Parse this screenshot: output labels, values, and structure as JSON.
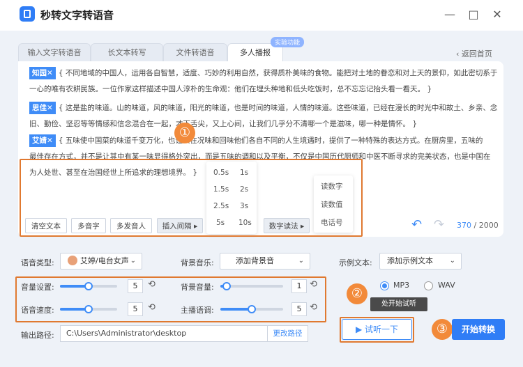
{
  "app": {
    "title": "秒转文字转语音",
    "logo": "app-logo-icon"
  },
  "window": {
    "minimize": "—",
    "restore": "□",
    "close": "✕"
  },
  "tabs": [
    {
      "label": "输入文字转语音",
      "active": false
    },
    {
      "label": "长文本转写",
      "active": false
    },
    {
      "label": "文件转语音",
      "active": false
    },
    {
      "label": "多人播报",
      "active": true
    }
  ],
  "badge": "实验功能",
  "back_label": "返回首页",
  "paragraphs": [
    {
      "tag": "知园✕",
      "lines": [
        "{ 不同地域的中国人，运用各自智慧，适度、巧妙的利用自然，获得质朴美味的食物。能把对土地的眷恋和对上天的景仰，如此密切系于",
        "一心的唯有农耕民族。一位作家这样描述中国人淳朴的生命观：他们在埋头种地和低头吃饭时，总不忘忘记抬头看一看天。 }"
      ]
    },
    {
      "tag": "思佳✕",
      "lines": [
        "{ 这是盐的味道。山的味道，风的味道，阳光的味道，也是时间的味道，人情的味道。这些味道，已经在漫长的时光中和故土、乡亲、念",
        "旧、勤俭、坚忍等等情感和信念混合在一起，才下舌尖，又上心间，让我们几乎分不清哪一个是滋味，哪一种是情怀。 }"
      ]
    },
    {
      "tag": "艾婧✕",
      "lines": [
        "{ 五味使中国菜的味道千变万化，也让人在况味和回味他们各自不同的人生境遇时，提供了一种特殊的表达方式。在厨房里，五味的",
        "最佳存在方式，并不是让其中有某一味显得格外突出，而是五味的调和以及平衡，不仅是中国历代厨师和中医不断寻求的完美状态，也是中国在",
        "为人处世、甚至在治国经世上所追求的理想境界。 }"
      ]
    }
  ],
  "pause_popup": [
    "0.5s",
    "1s",
    "1.5s",
    "2s",
    "2.5s",
    "3s",
    "5s",
    "10s"
  ],
  "digit_popup": [
    "读数字",
    "读数值",
    "电话号"
  ],
  "toolbar": {
    "clear": "清空文本",
    "polyphone": "多音字",
    "multi": "多发音人",
    "pause": "插入间隔 ▸",
    "digit": "数字读法 ▸"
  },
  "counter": {
    "current": "370",
    "max": "/ 2000"
  },
  "settings": {
    "voice_type_label": "语音类型:",
    "voice_value": "艾婷/电台女声",
    "bgm_label": "背景音乐:",
    "bgm_value": "添加背景音",
    "sample_label": "示例文本:",
    "sample_value": "添加示例文本",
    "volume_label": "音量设置:",
    "volume_value": "5",
    "speed_label": "语音速度:",
    "speed_value": "5",
    "bg_volume_label": "背景音量:",
    "bg_volume_value": "1",
    "pitch_label": "主播语调:",
    "pitch_value": "5",
    "format_mp3": "MP3",
    "format_wav": "WAV",
    "output_label": "输出路径:",
    "output_path": "C:\\Users\\Administrator\\desktop",
    "change_path": "更改路径"
  },
  "sliders": {
    "volume": 0.5,
    "speed": 0.5,
    "bg_volume": 0.1,
    "pitch": 0.5
  },
  "tooltip": "处开始试听",
  "listen_label": "▶  试听一下",
  "start_label": "开始转换",
  "callouts": [
    "①",
    "②",
    "③"
  ]
}
